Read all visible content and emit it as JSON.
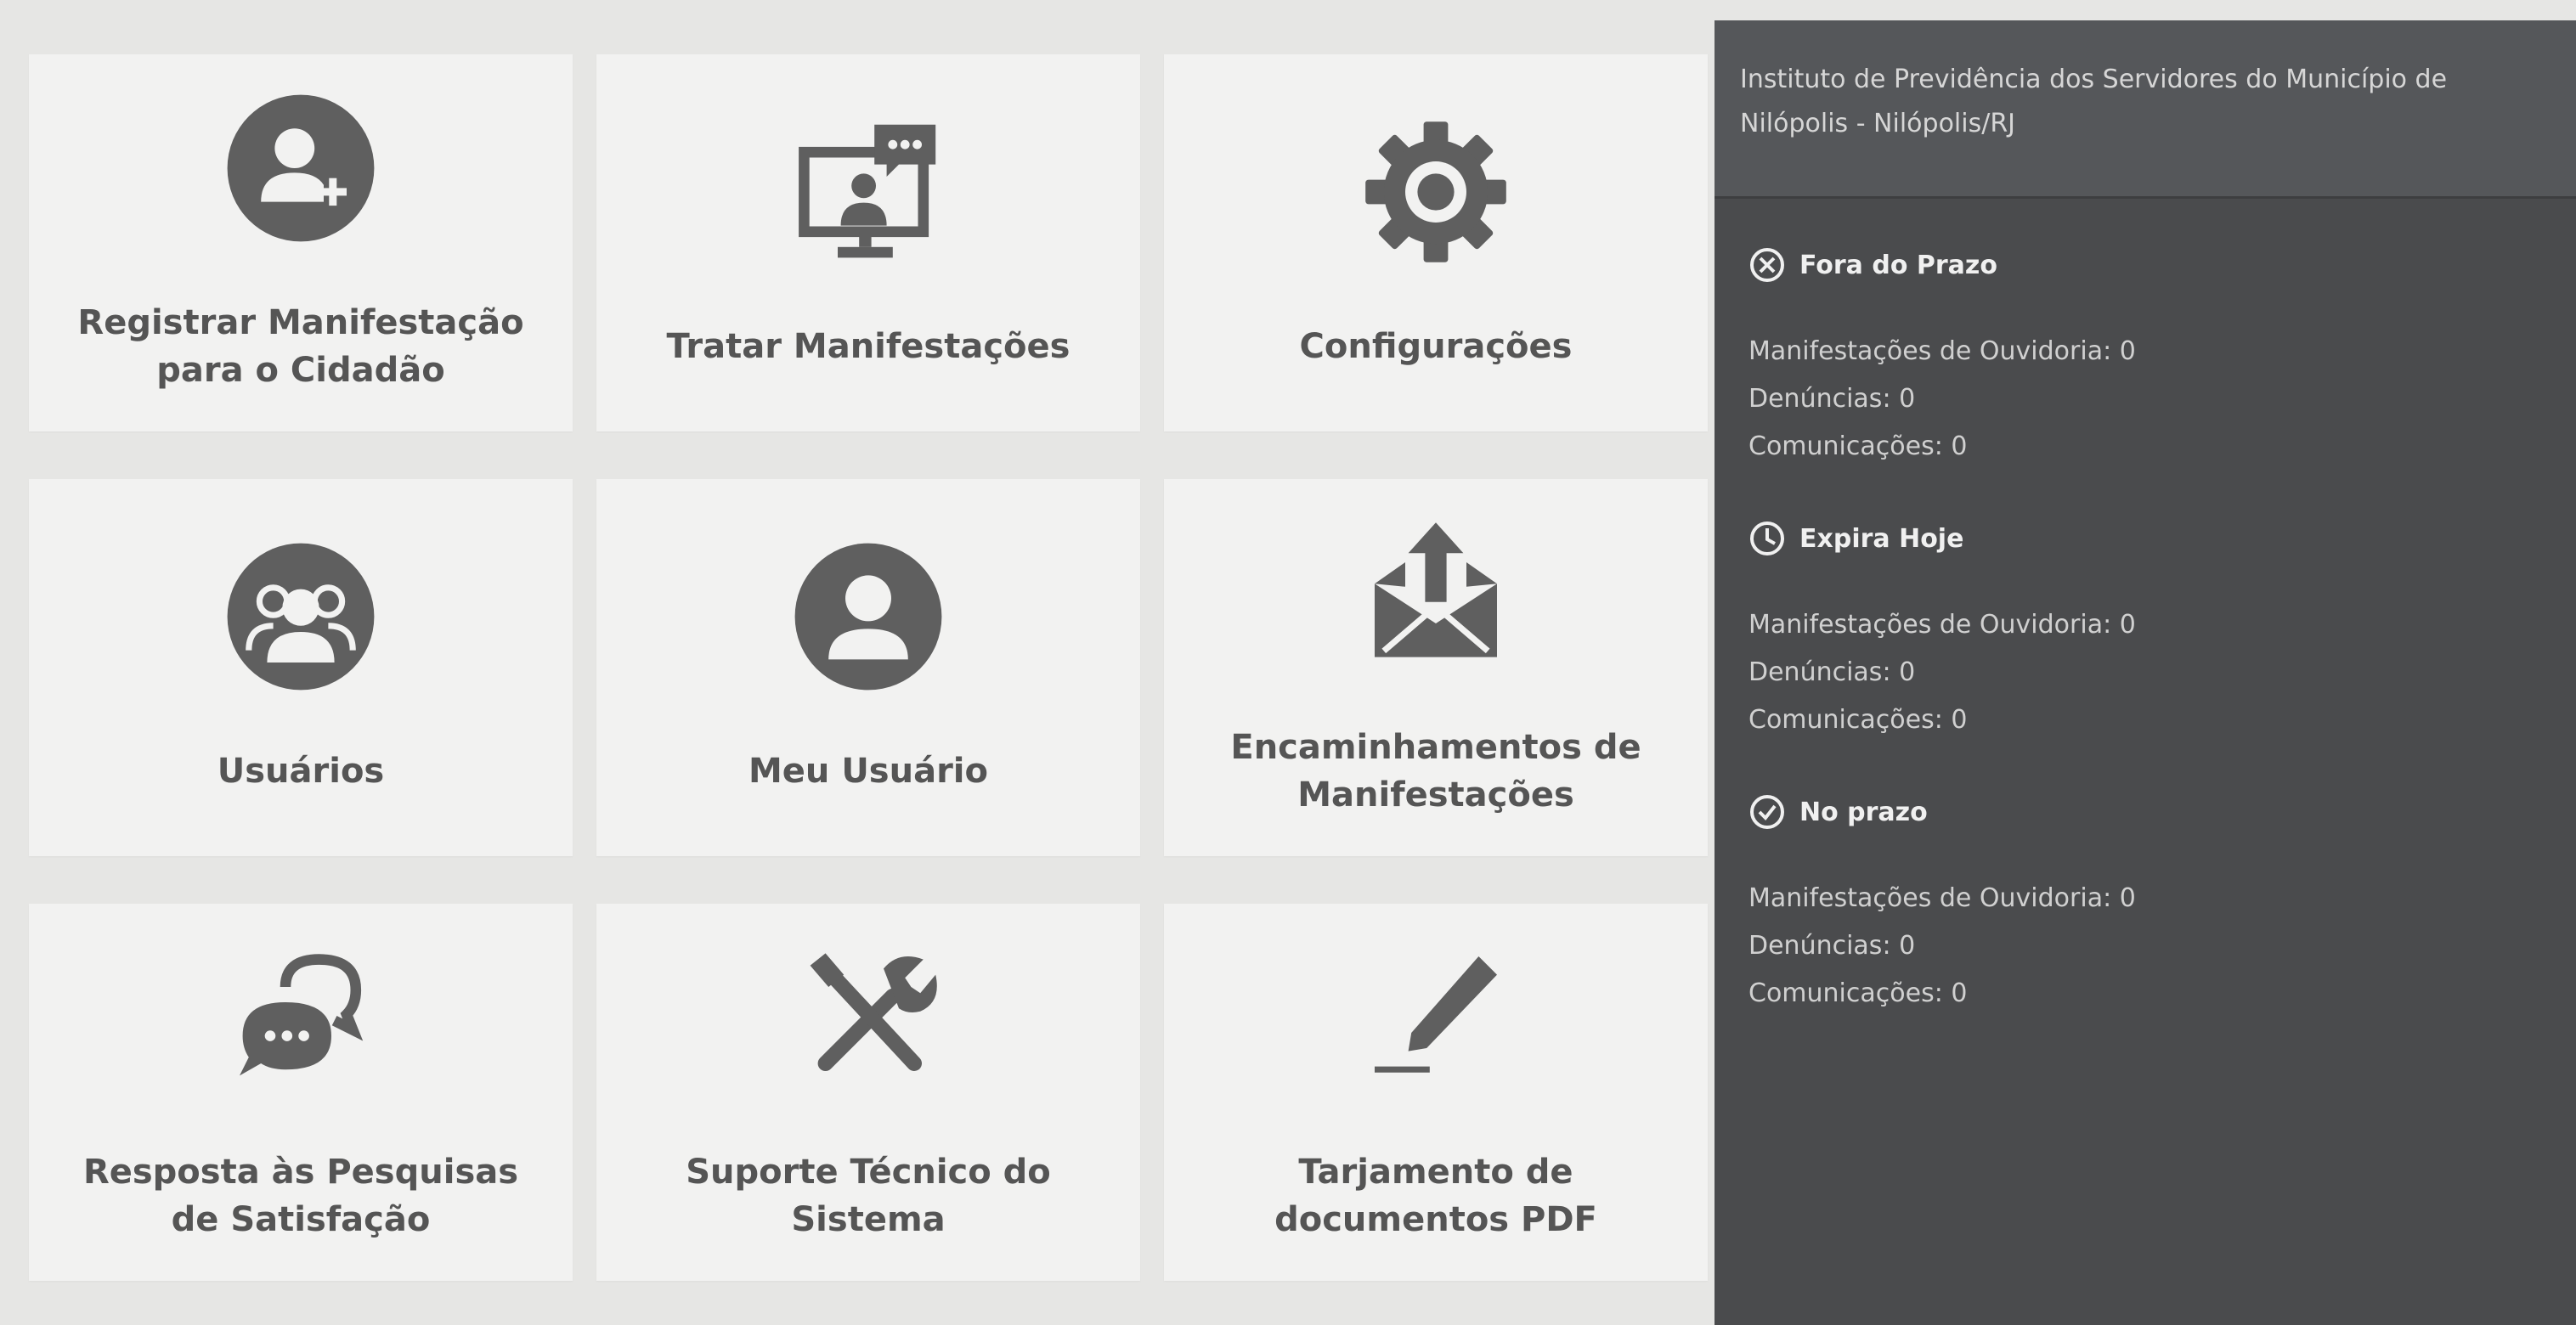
{
  "tiles": [
    {
      "label": "Registrar Manifestação\npara o Cidadão",
      "icon": "add-user-icon"
    },
    {
      "label": "Tratar Manifestações",
      "icon": "monitor-chat-icon"
    },
    {
      "label": "Configurações",
      "icon": "gear-icon"
    },
    {
      "label": "Usuários",
      "icon": "users-icon"
    },
    {
      "label": "Meu Usuário",
      "icon": "user-icon"
    },
    {
      "label": "Encaminhamentos de\nManifestações",
      "icon": "envelope-upload-icon"
    },
    {
      "label": "Resposta às Pesquisas\nde Satisfação",
      "icon": "chat-bubbles-icon"
    },
    {
      "label": "Suporte Técnico do\nSistema",
      "icon": "tools-icon"
    },
    {
      "label": "Tarjamento de\ndocumentos PDF",
      "icon": "pen-icon"
    }
  ],
  "panel": {
    "organization": "Instituto de Previdência dos Servidores do Município de Nilópolis - Nilópolis/RJ",
    "sections": [
      {
        "title": "Fora do Prazo",
        "icon": "x-circle-icon",
        "rows": [
          "Manifestações de Ouvidoria: 0",
          "Denúncias: 0",
          "Comunicações: 0"
        ]
      },
      {
        "title": "Expira Hoje",
        "icon": "clock-icon",
        "rows": [
          "Manifestações de Ouvidoria: 0",
          "Denúncias: 0",
          "Comunicações: 0"
        ]
      },
      {
        "title": "No prazo",
        "icon": "check-circle-icon",
        "rows": [
          "Manifestações de Ouvidoria: 0",
          "Denúncias: 0",
          "Comunicações: 0"
        ]
      }
    ]
  },
  "colors": {
    "background": "#e6e6e4",
    "tile": "#f2f2f1",
    "icon": "#5f5f5f",
    "label": "#555555",
    "panel": "#4a4b4d",
    "panel_header": "#55575a"
  }
}
